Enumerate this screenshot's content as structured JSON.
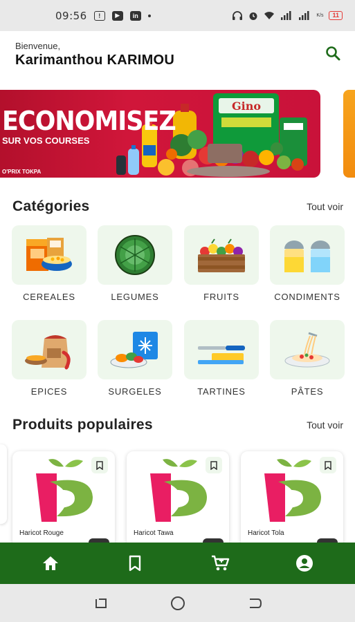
{
  "status_bar": {
    "time": "09:56",
    "icons": [
      "sim-icon",
      "youtube-icon",
      "linkedin-icon",
      "dot-icon",
      "headphones-icon",
      "alarm-icon",
      "wifi-icon",
      "signal-icon",
      "signal-icon",
      "battery-icon"
    ],
    "battery_level": "11",
    "network_label": "K/s"
  },
  "header": {
    "welcome": "Bienvenue,",
    "username": "Karimanthou KARIMOU",
    "search_icon": "search-icon"
  },
  "banner": {
    "title": "ECONOMISEZ",
    "subtitle": "SUR VOS COURSES",
    "brand": "O'PRIX TOKPA",
    "product_label": "Gino"
  },
  "categories": {
    "title": "Catégories",
    "see_all": "Tout voir",
    "items": [
      {
        "label": "CEREALES",
        "icon": "cereals-icon"
      },
      {
        "label": "LEGUMES",
        "icon": "cabbage-icon"
      },
      {
        "label": "FRUITS",
        "icon": "fruit-crate-icon"
      },
      {
        "label": "CONDIMENTS",
        "icon": "salt-pepper-icon"
      },
      {
        "label": "EPICES",
        "icon": "spices-icon"
      },
      {
        "label": "SURGELES",
        "icon": "frozen-food-icon"
      },
      {
        "label": "TARTINES",
        "icon": "butter-knife-icon"
      },
      {
        "label": "PÂTES",
        "icon": "pasta-icon"
      }
    ]
  },
  "popular": {
    "title": "Produits populaires",
    "see_all": "Tout voir",
    "items": [
      {
        "name": "Haricot Rouge"
      },
      {
        "name": "Haricot Tawa"
      },
      {
        "name": "Haricot Tola"
      }
    ]
  },
  "bottom_nav": [
    "home-icon",
    "bookmark-icon",
    "cart-icon",
    "account-icon"
  ],
  "system_nav": [
    "recent-apps-icon",
    "home-circle-icon",
    "back-icon"
  ],
  "colors": {
    "primary_green": "#1e6b1a",
    "tile_bg": "#eef7ec",
    "banner_red": "#c9123a",
    "logo_pink": "#e91e63",
    "logo_green": "#7cb342"
  }
}
